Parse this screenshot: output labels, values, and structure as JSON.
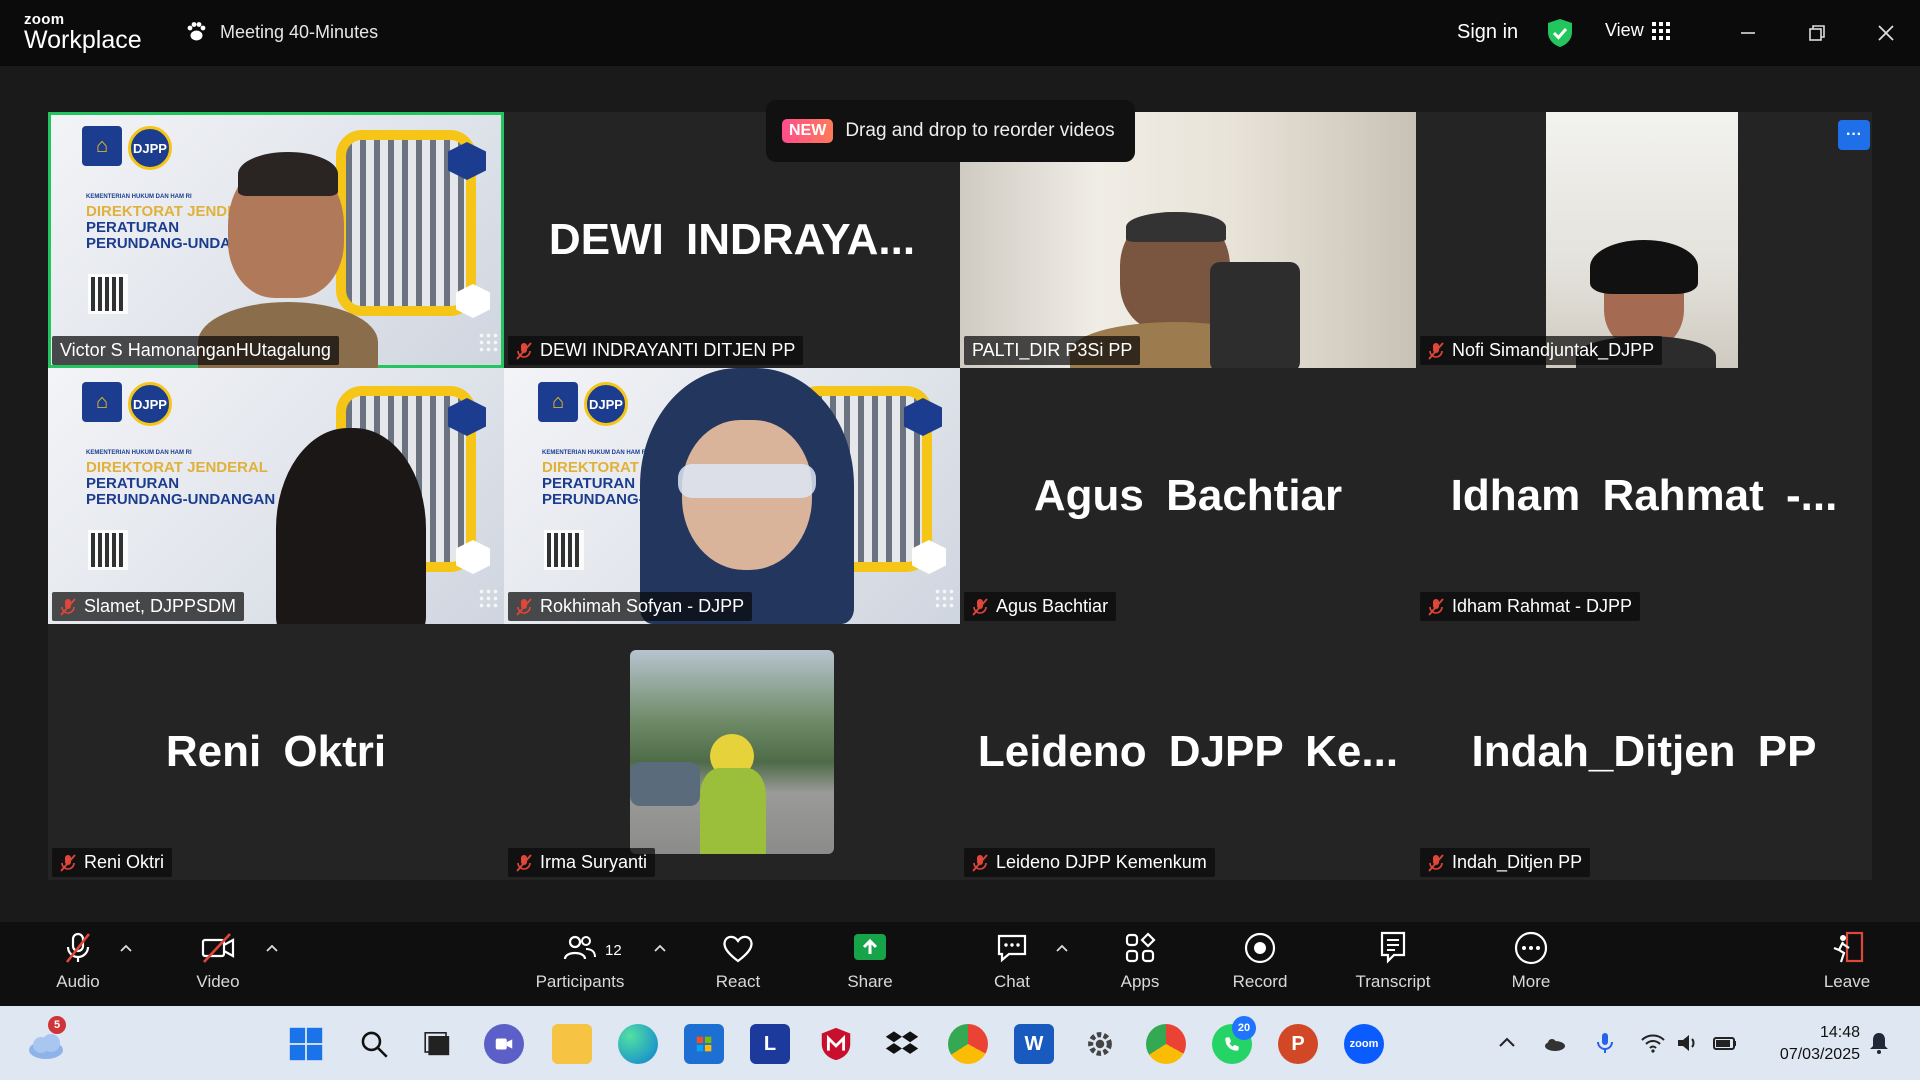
{
  "titlebar": {
    "logo_top": "zoom",
    "logo_bottom": "Workplace",
    "meeting_title": "Meeting 40-Minutes",
    "sign_in": "Sign in",
    "view_label": "View"
  },
  "tooltip": {
    "badge": "NEW",
    "text": "Drag and drop to reorder videos"
  },
  "more_options": "···",
  "tiles": [
    {
      "big": "",
      "label": "Victor S HamonanganHUtagalung",
      "active": true,
      "muted": false
    },
    {
      "big": "DEWI INDRAYA...",
      "label": "DEWI INDRAYANTI DITJEN PP",
      "muted": true
    },
    {
      "big": "",
      "label": "PALTI_DIR P3Si PP",
      "muted": false
    },
    {
      "big": "",
      "label": "Nofi Simandjuntak_DJPP",
      "muted": true
    },
    {
      "big": "",
      "label": "Slamet, DJPPSDM",
      "muted": true
    },
    {
      "big": "",
      "label": "Rokhimah Sofyan - DJPP",
      "muted": true
    },
    {
      "big": "Agus Bachtiar",
      "label": "Agus Bachtiar",
      "muted": true
    },
    {
      "big": "Idham Rahmat -...",
      "label": "Idham Rahmat - DJPP",
      "muted": true
    },
    {
      "big": "Reni Oktri",
      "label": "Reni Oktri",
      "muted": true
    },
    {
      "big": "",
      "label": "Irma Suryanti",
      "muted": true
    },
    {
      "big": "Leideno DJPP Ke...",
      "label": "Leideno DJPP Kemenkum",
      "muted": true
    },
    {
      "big": "Indah_Ditjen PP",
      "label": "Indah_Ditjen PP",
      "muted": true
    }
  ],
  "slide": {
    "ministry": "KEMENTERIAN HUKUM DAN HAM RI",
    "line1": "DIREKTORAT JENDERAL",
    "line2": "PERATURAN",
    "line3": "PERUNDANG-UNDANGAN",
    "badge": "DJPP"
  },
  "toolbar": {
    "audio": "Audio",
    "video": "Video",
    "participants": "Participants",
    "participant_count": "12",
    "react": "React",
    "share": "Share",
    "chat": "Chat",
    "apps": "Apps",
    "record": "Record",
    "transcript": "Transcript",
    "more": "More",
    "leave": "Leave"
  },
  "taskbar": {
    "weather_badge": "5",
    "whatsapp_badge": "20",
    "time": "14:48",
    "date": "07/03/2025",
    "launcher_letter": "L"
  },
  "colors": {
    "active_speaker": "#22c55e",
    "share_green": "#16a34a",
    "muted_red": "#e0463a",
    "accent_blue": "#1e6fe8"
  }
}
